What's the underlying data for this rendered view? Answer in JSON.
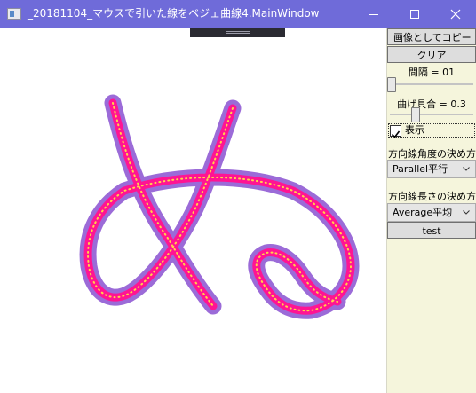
{
  "window": {
    "title": "_20181104_マウスで引いた線をベジェ曲線4.MainWindow"
  },
  "panel": {
    "copy_button_label": "画像としてコピー",
    "clear_button_label": "クリア",
    "interval_label": "間隔 = 01",
    "interval_value": 1,
    "curve_label": "曲げ具合 = 0.3",
    "curve_value": 0.3,
    "show_checkbox_label": "表示",
    "show_checked": true,
    "direction_angle_label": "方向線角度の決め方",
    "direction_angle_selected": "Parallel平行",
    "direction_length_label": "方向線長さの決め方",
    "direction_length_selected": "Average平均",
    "test_button_label": "test"
  },
  "drawing": {
    "glyph": "ぬ",
    "outer_stroke_color": "#9b6bd8",
    "inner_stroke_color": "#ff1493",
    "point_color": "#ffd24a"
  },
  "colors": {
    "titlebar": "#6f6bd9",
    "panel_background": "#f5f5dc"
  }
}
